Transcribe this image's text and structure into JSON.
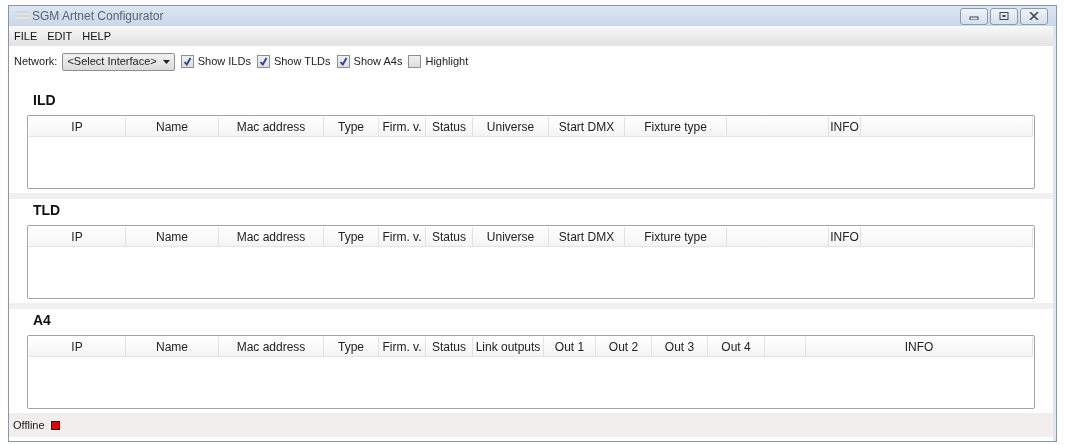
{
  "window": {
    "title": "SGM Artnet Configurator"
  },
  "menu": [
    "FILE",
    "EDIT",
    "HELP"
  ],
  "toolbar": {
    "network_label": "Network:",
    "network_value": "<Select Interface>",
    "checkboxes": [
      {
        "label": "Show ILDs",
        "checked": true
      },
      {
        "label": "Show TLDs",
        "checked": true
      },
      {
        "label": "Show A4s",
        "checked": true
      },
      {
        "label": "Highlight",
        "checked": false
      }
    ]
  },
  "sections": [
    {
      "title": "ILD",
      "kind": "fixture",
      "columns": [
        "IP",
        "Name",
        "Mac address",
        "Type",
        "Firm. v.",
        "Status",
        "Universe",
        "Start DMX",
        "Fixture type",
        "INFO"
      ]
    },
    {
      "title": "TLD",
      "kind": "fixture",
      "columns": [
        "IP",
        "Name",
        "Mac address",
        "Type",
        "Firm. v.",
        "Status",
        "Universe",
        "Start DMX",
        "Fixture type",
        "INFO"
      ]
    },
    {
      "title": "A4",
      "kind": "a4",
      "columns": [
        "IP",
        "Name",
        "Mac address",
        "Type",
        "Firm. v.",
        "Status",
        "Link outputs",
        "Out 1",
        "Out 2",
        "Out 3",
        "Out 4",
        "INFO"
      ]
    }
  ],
  "status_bar": {
    "text": "Offline",
    "color": "#e00000"
  }
}
